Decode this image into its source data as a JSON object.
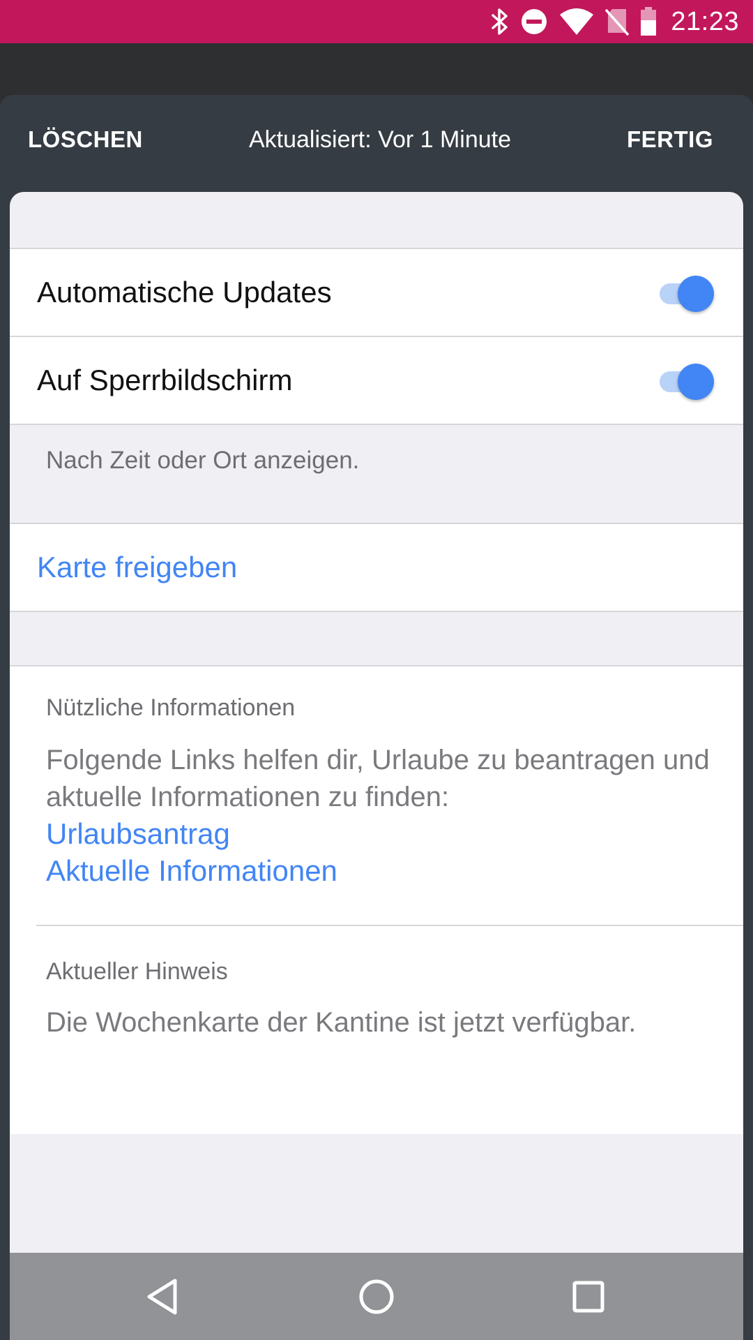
{
  "status_bar": {
    "time": "21:23",
    "icons": [
      "bluetooth-icon",
      "do-not-disturb-icon",
      "wifi-icon",
      "no-sim-icon",
      "battery-icon"
    ],
    "background_color": "#c2185b"
  },
  "header": {
    "left_action": "LÖSCHEN",
    "title": "Aktualisiert: Vor 1 Minute",
    "right_action": "FERTIG",
    "background_color": "#353c43"
  },
  "settings": {
    "items": [
      {
        "label": "Automatische Updates",
        "enabled": true
      },
      {
        "label": "Auf Sperrbildschirm",
        "enabled": true
      }
    ],
    "footer_note": "Nach Zeit oder Ort anzeigen.",
    "accent_color": "#4285f4"
  },
  "share": {
    "label": "Karte freigeben"
  },
  "info": {
    "useful": {
      "title": "Nützliche Informationen",
      "text": "Folgende Links helfen dir, Urlaube zu beantragen und aktuelle Informationen zu finden:",
      "links": [
        "Urlaubsantrag",
        "Aktuelle Informationen"
      ]
    },
    "notice": {
      "title": "Aktueller Hinweis",
      "text": "Die Wochenkarte der Kantine ist jetzt verfügbar."
    }
  },
  "nav_bar": {
    "buttons": [
      "back-icon",
      "home-icon",
      "recents-icon"
    ]
  }
}
